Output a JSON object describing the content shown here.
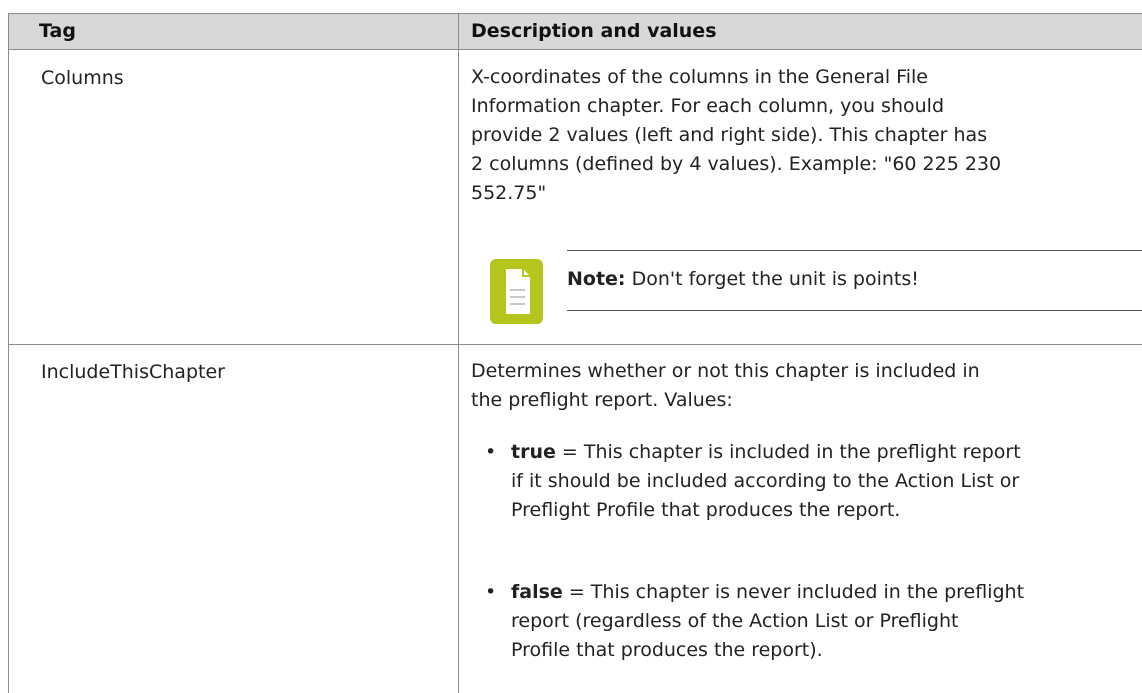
{
  "table": {
    "headers": {
      "tag": "Tag",
      "description": "Description and values"
    },
    "rows": [
      {
        "tag": "Columns",
        "description_lines": [
          "X-coordinates of the columns in the General File",
          "Information chapter. For each column, you should",
          "provide 2 values (left and right side). This chapter has",
          "2 columns (defined by 4 values). Example: \"60 225 230",
          "552.75\""
        ],
        "note": {
          "label": "Note:",
          "text": "Don't forget the unit is points!",
          "icon": "note-document-icon",
          "icon_color": "#b6c41e"
        }
      },
      {
        "tag": "IncludeThisChapter",
        "description_lines": [
          "Determines whether or not this chapter is included in",
          "the preflight report. Values:"
        ],
        "values": [
          {
            "term": "true",
            "lines": [
              " = This chapter is included in the preflight report",
              "if it should be included according to the Action List or",
              "Preflight Profile that produces the report."
            ]
          },
          {
            "term": "false",
            "lines": [
              " = This chapter is never included in the preflight",
              "report (regardless of the Action List or Preflight",
              "Profile that produces the report)."
            ]
          }
        ]
      }
    ]
  },
  "colors": {
    "header_background": "#d8d8d8",
    "border": "#8c8c8c",
    "text": "#222222"
  }
}
